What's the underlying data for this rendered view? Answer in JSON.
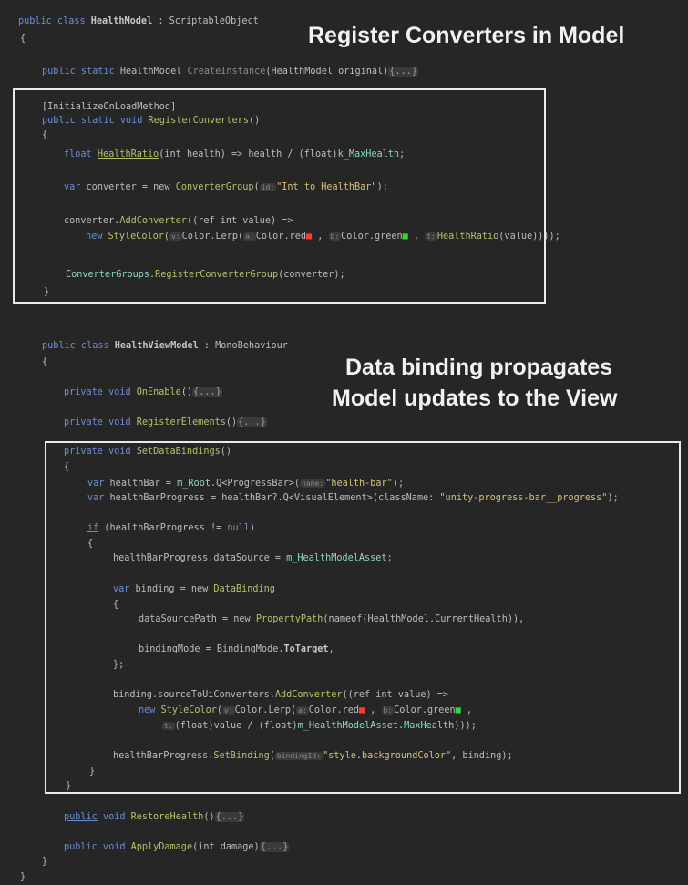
{
  "headings": {
    "register": "Register Converters in Model",
    "binding_line1": "Data binding propagates",
    "binding_line2": "Model updates to the View"
  },
  "model": {
    "decl_kw": "public class ",
    "decl_name": "HealthModel",
    "decl_base": " : ScriptableObject",
    "open_brace": "{",
    "create_kw": "public static ",
    "create_type": "HealthModel",
    "create_fn": " CreateInstance",
    "create_args": "(HealthModel original)",
    "fold": "{...}",
    "attr": "[InitializeOnLoadMethod]",
    "reg_kw": "public static void ",
    "reg_fn": "RegisterConverters",
    "reg_args": "()",
    "brace_open": "{",
    "ratio_kw": "float ",
    "ratio_fn": "HealthRatio",
    "ratio_rest": "(int health) => health / (float)",
    "ratio_field": "k_MaxHealth",
    "ratio_end": ";",
    "conv_kw": "var ",
    "conv_mid": "converter = new ",
    "conv_type": "ConverterGroup",
    "conv_open": "(",
    "conv_hint": "id:",
    "conv_str": "\"Int to HealthBar\"",
    "conv_end": ");",
    "add_text": "converter.",
    "add_fn": "AddConverter",
    "add_args": "((ref int value) =>",
    "style_kw": "new ",
    "style_type": "StyleColor",
    "style_open": "(",
    "style_hint1": "v:",
    "style_lerp": "Color.Lerp(",
    "style_hint2": "a:",
    "style_red": "Color.red",
    "swatch": "■",
    "style_sep": " , ",
    "style_hint3": "b:",
    "style_green": "Color.green",
    "style_hint4": "t:",
    "style_ratio": "HealthRatio",
    "style_end": "(value))));",
    "groups": "ConverterGroups.",
    "groups_fn": "RegisterConverterGroup",
    "groups_args": "(converter);",
    "brace_close": "}"
  },
  "view": {
    "decl_kw": "public class ",
    "decl_name": "HealthViewModel",
    "decl_base": " : MonoBehaviour",
    "open_brace": "{",
    "enable_kw": "private void ",
    "enable_fn": "OnEnable",
    "paren": "()",
    "fold": "{...}",
    "reg_kw": "private void ",
    "reg_fn": "RegisterElements",
    "set_kw": "private void ",
    "set_fn": "SetDataBindings",
    "brace_open": "{",
    "hb_kw": "var ",
    "hb_mid": "healthBar = ",
    "hb_field": "m_Root",
    "hb_q": ".Q<ProgressBar>(",
    "hb_hint": "name:",
    "hb_str": "\"health-bar\"",
    "hb_end": ");",
    "hbp_kw": "var ",
    "hbp_mid": "healthBarProgress = healthBar?.Q<VisualElement>(className: ",
    "hbp_str": "\"unity-progress-bar__progress\"",
    "hbp_end": ");",
    "if_kw": "if",
    "if_rest": " (healthBarProgress != ",
    "if_null": "null",
    "if_end": ")",
    "ds_text": "healthBarProgress.dataSource = ",
    "ds_field": "m_HealthModelAsset",
    "ds_end": ";",
    "db_kw": "var ",
    "db_mid": "binding = new ",
    "db_type": "DataBinding",
    "dsp_text": "dataSourcePath = new ",
    "dsp_type": "PropertyPath",
    "dsp_rest": "(nameof(HealthModel.CurrentHealth)),",
    "bm_text": "bindingMode = BindingMode.",
    "bm_val": "ToTarget",
    "bm_end": ",",
    "close_semi": "};",
    "src_text": "binding.sourceToUiConverters.",
    "src_fn": "AddConverter",
    "src_args": "((ref int value) =>",
    "sc_kw": "new ",
    "sc_type": "StyleColor",
    "sc_open": "(",
    "sc_hint1": "v:",
    "sc_lerp": "Color.Lerp(",
    "sc_hint2": "a:",
    "sc_red": "Color.red",
    "swatch": "■",
    "sc_sep": " , ",
    "sc_hint3": "b:",
    "sc_green": "Color.green",
    "sc_end": " ,",
    "fl_hint": "t:",
    "fl_text": "(float)value / (float)",
    "fl_field": "m_HealthModelAsset.MaxHealth",
    "fl_end": ")));",
    "sb_text": "healthBarProgress.",
    "sb_fn": "SetBinding",
    "sb_open": "(",
    "sb_hint": "bindingId:",
    "sb_str": "\"style.backgroundColor\"",
    "sb_end": ", binding);",
    "brace_close": "}",
    "restore_kw": "public",
    "restore_rest": " void ",
    "restore_fn": "RestoreHealth",
    "apply_kw": "public void ",
    "apply_fn": "ApplyDamage",
    "apply_args": "(int damage)"
  }
}
